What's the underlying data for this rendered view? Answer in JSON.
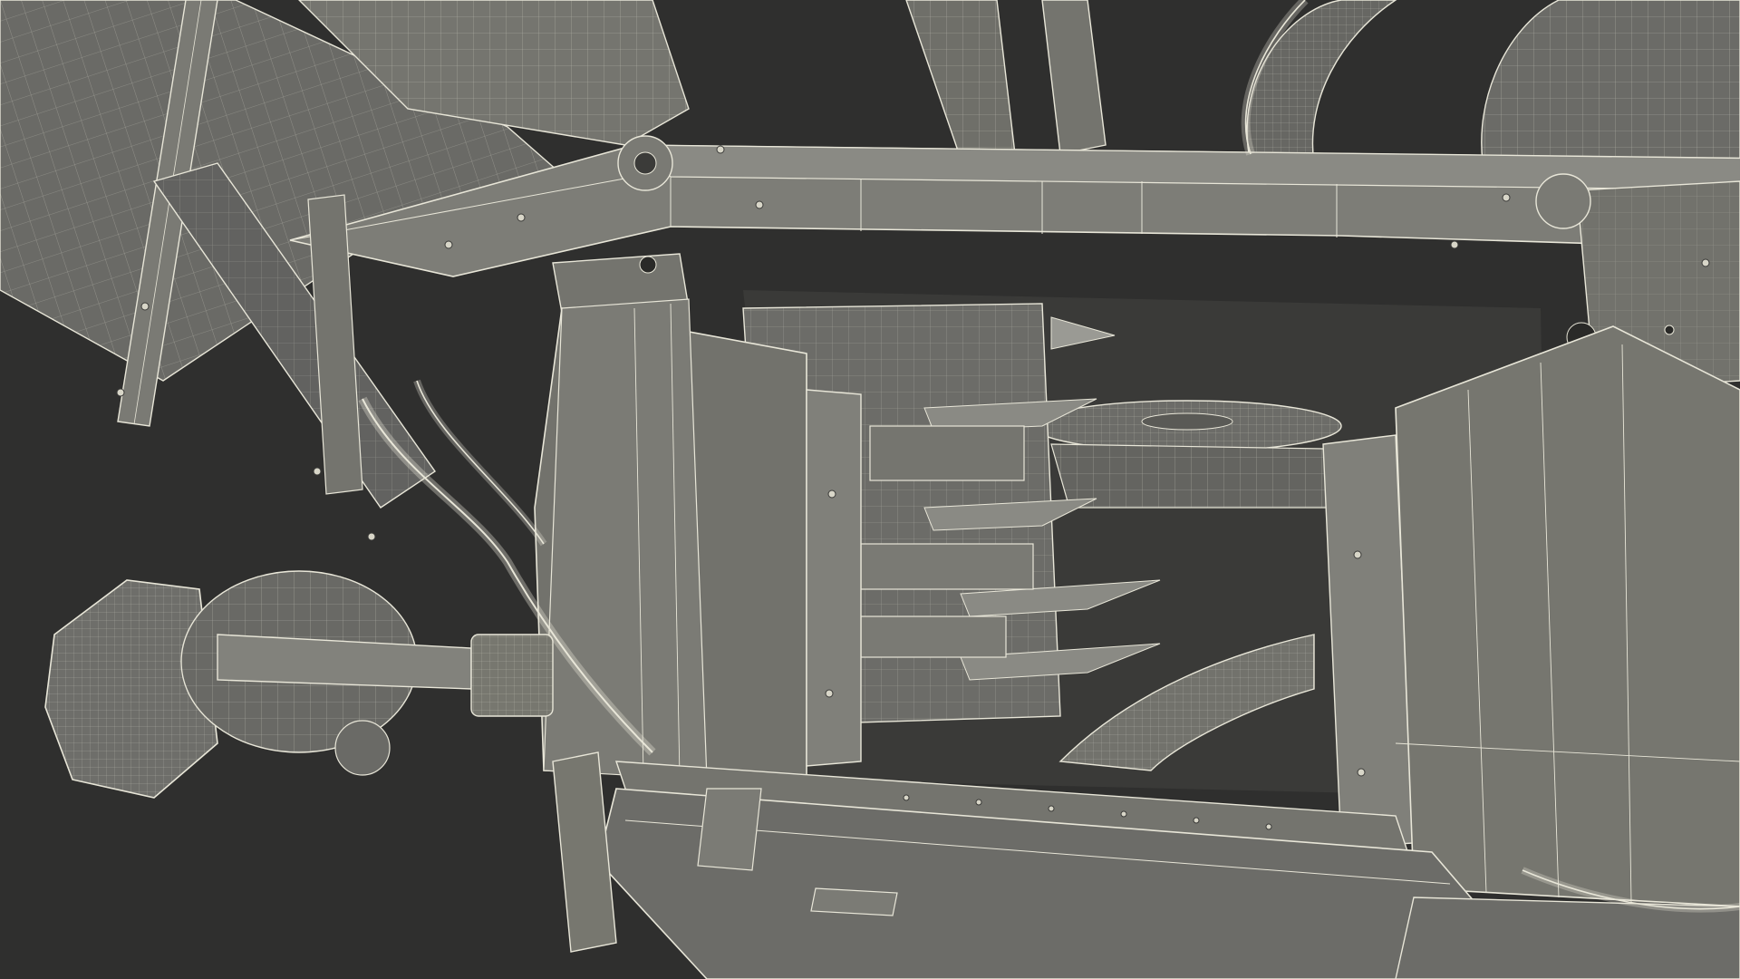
{
  "scene": {
    "background": "#2f2f2e",
    "surface": "#6f6f6a",
    "surface_light": "#85857f",
    "surface_dark": "#4e4e4a",
    "wire": "#e8e6d8",
    "subject": "wireframe-machinery-render"
  }
}
